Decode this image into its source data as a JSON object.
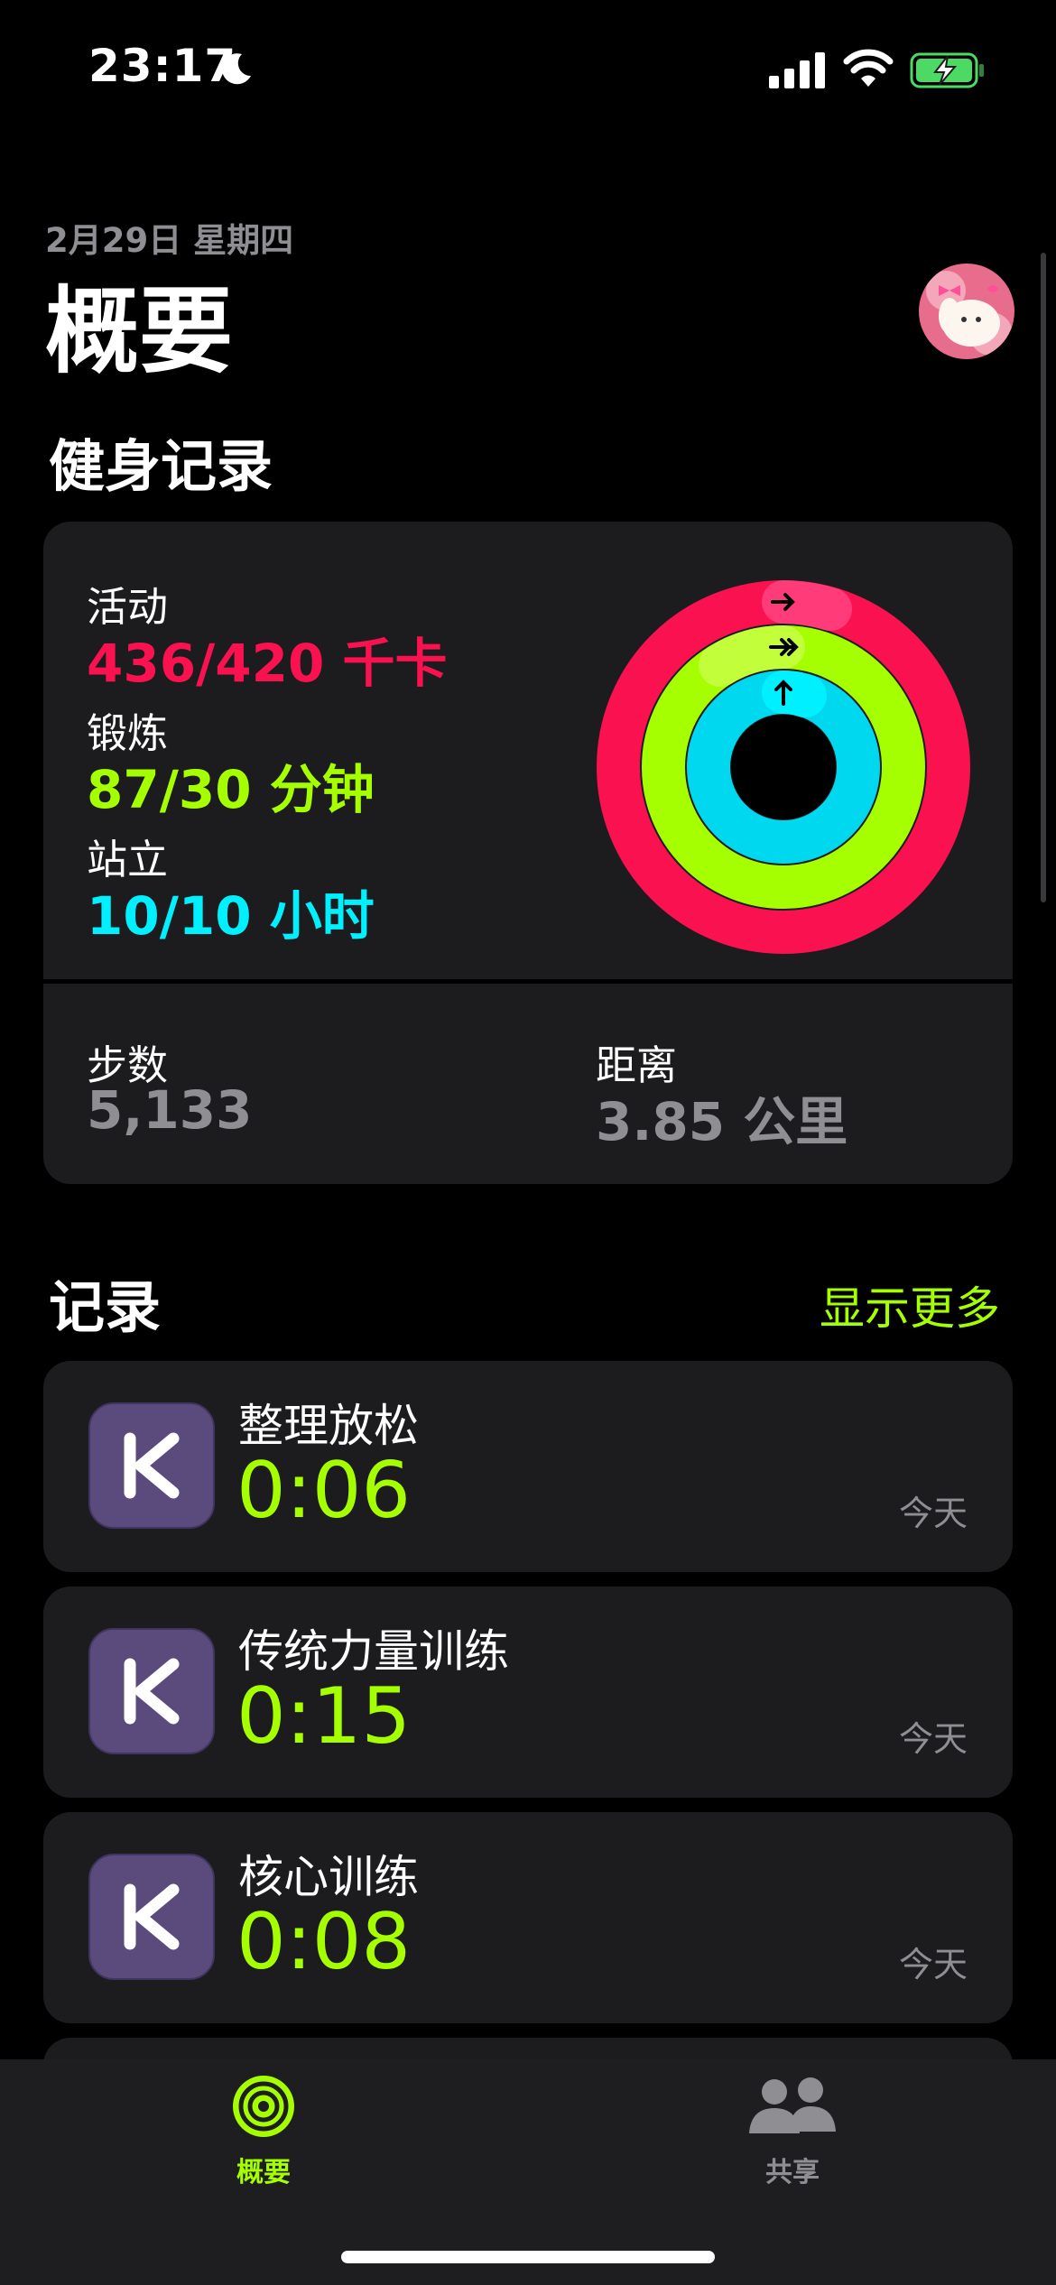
{
  "status_bar": {
    "time": "23:17"
  },
  "header": {
    "date": "2月29日 星期四",
    "title": "概要"
  },
  "fitness": {
    "section_title": "健身记录",
    "move": {
      "label": "活动",
      "value": "436/420 千卡",
      "color": "#fa114f"
    },
    "exercise": {
      "label": "锻炼",
      "value": "87/30 分钟",
      "color": "#a6ff00"
    },
    "stand": {
      "label": "站立",
      "value": "10/10 小时",
      "color": "#00f0ff"
    },
    "steps": {
      "label": "步数",
      "value": "5,133"
    },
    "distance": {
      "label": "距离",
      "value": "3.85 公里"
    }
  },
  "records": {
    "section_title": "记录",
    "show_more": "显示更多",
    "items": [
      {
        "name": "整理放松",
        "duration": "0:06",
        "when": "今天",
        "icon": "keep-app-icon"
      },
      {
        "name": "传统力量训练",
        "duration": "0:15",
        "when": "今天",
        "icon": "keep-app-icon"
      },
      {
        "name": "核心训练",
        "duration": "0:08",
        "when": "今天",
        "icon": "keep-app-icon"
      }
    ]
  },
  "tab_bar": {
    "tabs": [
      {
        "label": "概要",
        "icon": "activity-rings-icon",
        "active": true
      },
      {
        "label": "共享",
        "icon": "people-icon",
        "active": false
      }
    ]
  },
  "colors": {
    "accent": "#a6ff00",
    "card": "#1c1c1e",
    "secondary_text": "#8e8e93"
  }
}
